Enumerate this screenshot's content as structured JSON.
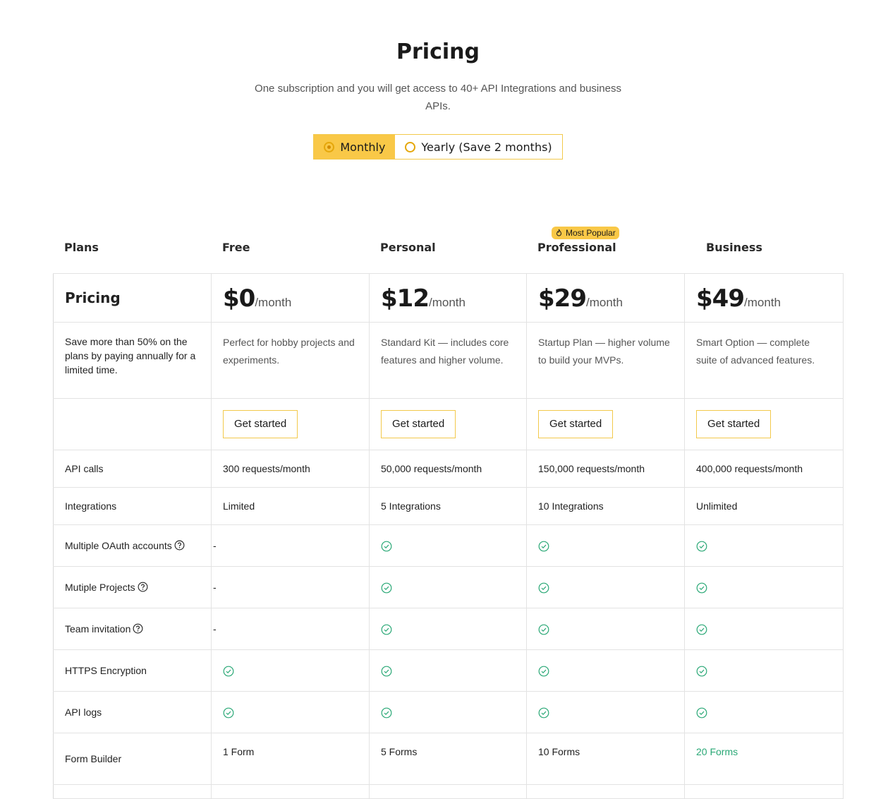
{
  "header": {
    "title": "Pricing",
    "subtitle": "One subscription and you will get access to 40+ API Integrations and business APIs."
  },
  "billing_toggle": {
    "monthly_label": "Monthly",
    "yearly_label": "Yearly (Save 2 months)",
    "selected": "Monthly"
  },
  "plans_header": {
    "plans_label": "Plans",
    "free": "Free",
    "personal": "Personal",
    "professional": "Professional",
    "business": "Business",
    "badge": "Most Popular"
  },
  "pricing_row": {
    "label": "Pricing",
    "per": "/month",
    "free": "$0",
    "personal": "$12",
    "professional": "$29",
    "business": "$49"
  },
  "description_row": {
    "note": "Save more than 50% on the plans by paying annually for a limited time.",
    "free": "Perfect for hobby projects and experiments.",
    "personal": "Standard Kit — includes core features and higher volume.",
    "professional": "Startup Plan — higher volume to build your MVPs.",
    "business": "Smart Option — complete suite of advanced features."
  },
  "cta_label": "Get started",
  "features": {
    "api_calls": {
      "label": "API calls",
      "free": "300 requests/month",
      "personal": "50,000 requests/month",
      "professional": "150,000 requests/month",
      "business": "400,000 requests/month"
    },
    "integrations": {
      "label": "Integrations",
      "free": "Limited",
      "personal": "5 Integrations",
      "professional": "10 Integrations",
      "business": "Unlimited"
    },
    "oauth": {
      "label": "Multiple OAuth accounts",
      "free": "-"
    },
    "projects": {
      "label": "Mutiple Projects",
      "free": "-"
    },
    "team": {
      "label": "Team invitation",
      "free": "-"
    },
    "https": {
      "label": "HTTPS Encryption"
    },
    "logs": {
      "label": "API logs"
    },
    "forms": {
      "label": "Form Builder",
      "free": "1 Form",
      "personal": "5 Forms",
      "professional": "10 Forms",
      "business": "20 Forms"
    }
  },
  "colors": {
    "accent": "#f9c847",
    "check": "#2aa876",
    "border": "#e3e3e3"
  }
}
